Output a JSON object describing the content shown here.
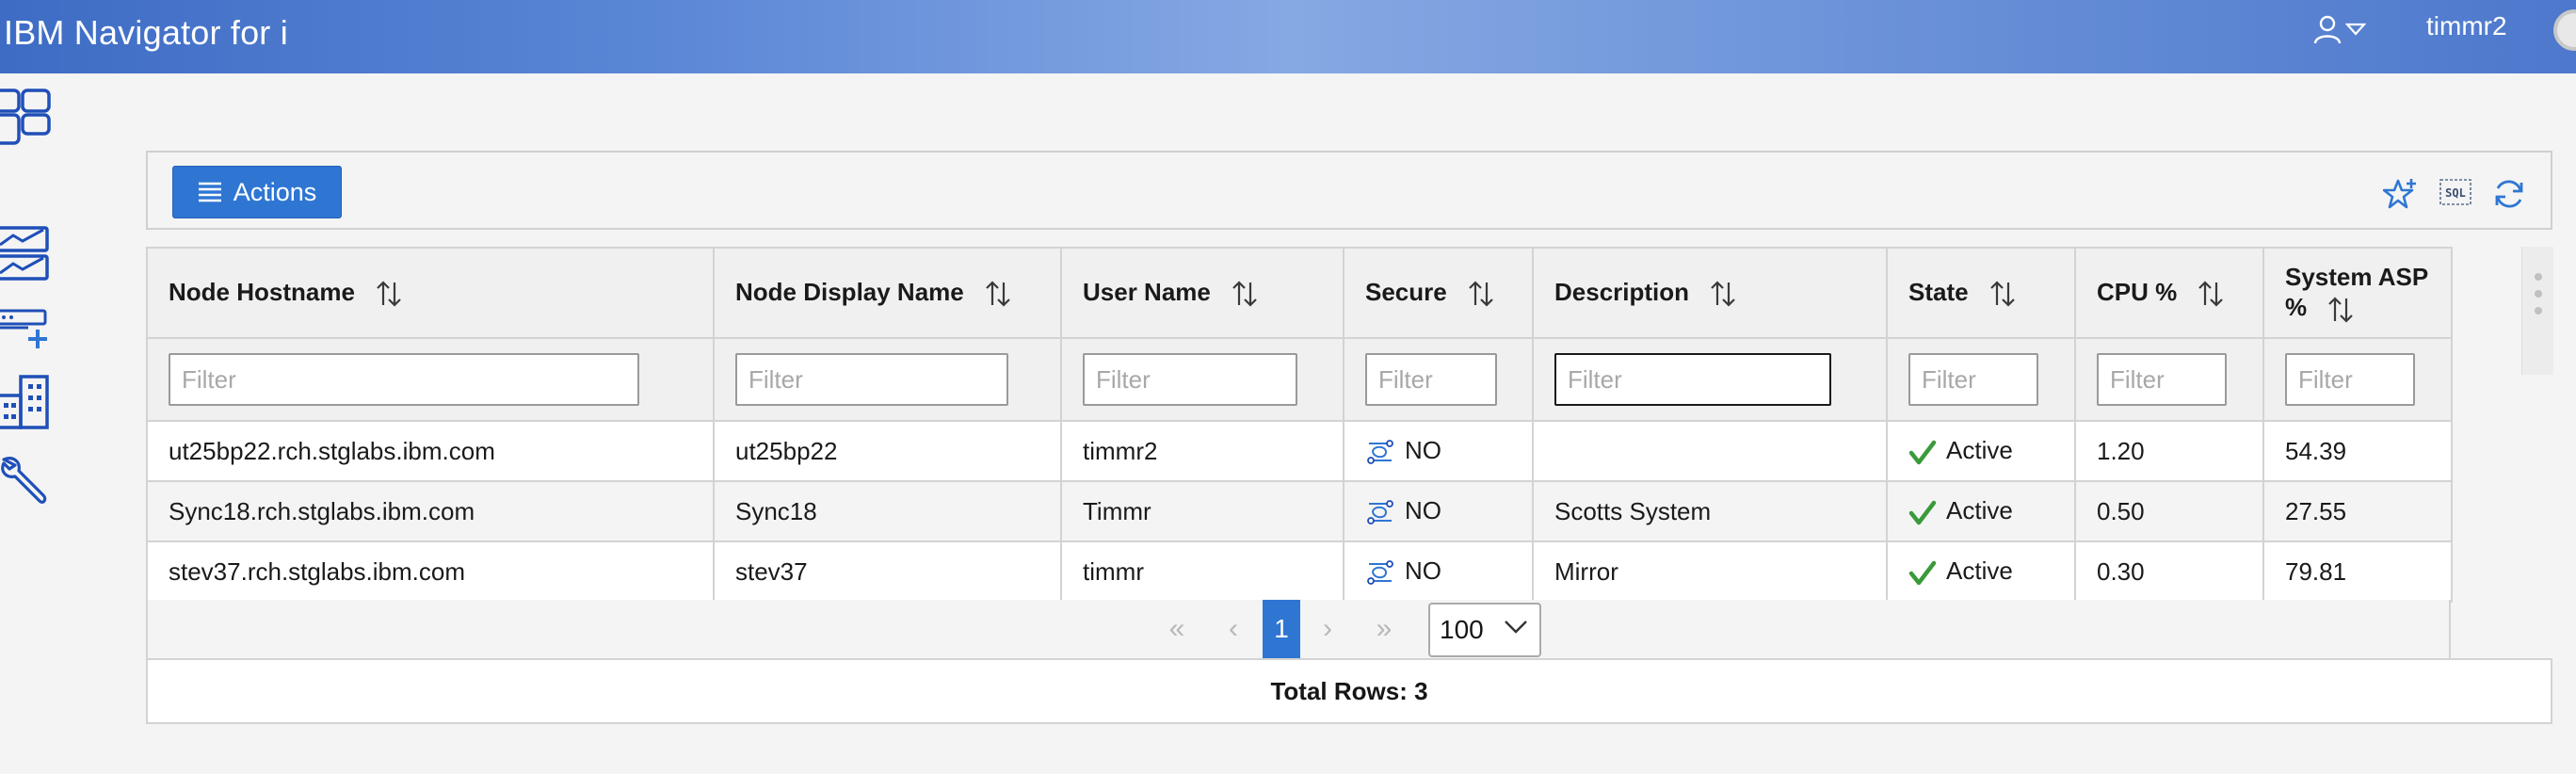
{
  "header": {
    "title": "IBM Navigator for i",
    "username": "timmr2",
    "user_icon": "user-icon",
    "menu_icon": "caret-down-icon"
  },
  "leftnav": {
    "items": [
      {
        "icon": "dashboard-icon"
      },
      {
        "icon": "monitor-icon"
      },
      {
        "icon": "add-system-icon"
      },
      {
        "icon": "building-icon"
      },
      {
        "icon": "wrench-icon"
      }
    ]
  },
  "toolbar": {
    "actions_label": "Actions",
    "icons": [
      "favorite-star-icon",
      "sql-icon",
      "refresh-icon"
    ]
  },
  "table": {
    "columns": [
      {
        "label": "Node Hostname"
      },
      {
        "label": "Node Display Name"
      },
      {
        "label": "User Name"
      },
      {
        "label": "Secure"
      },
      {
        "label": "Description"
      },
      {
        "label": "State"
      },
      {
        "label": "CPU %"
      },
      {
        "label": "System ASP %"
      }
    ],
    "filter_placeholder": "Filter",
    "rows": [
      {
        "hostname": "ut25bp22.rch.stglabs.ibm.com",
        "display_name": "ut25bp22",
        "user": "timmr2",
        "secure": "NO",
        "description": "",
        "state": "Active",
        "cpu": "1.20",
        "asp": "54.39"
      },
      {
        "hostname": "Sync18.rch.stglabs.ibm.com",
        "display_name": "Sync18",
        "user": "Timmr",
        "secure": "NO",
        "description": "Scotts System",
        "state": "Active",
        "cpu": "0.50",
        "asp": "27.55"
      },
      {
        "hostname": "stev37.rch.stglabs.ibm.com",
        "display_name": "stev37",
        "user": "timmr",
        "secure": "NO",
        "description": "Mirror",
        "state": "Active",
        "cpu": "0.30",
        "asp": "79.81"
      }
    ]
  },
  "pager": {
    "first": "«",
    "prev": "‹",
    "current_page": "1",
    "next": "›",
    "last": "»",
    "page_size": "100"
  },
  "footer": {
    "total_rows": "Total Rows: 3"
  },
  "colors": {
    "accent": "#2f76d3",
    "active_check": "#3a9a3a",
    "icon_blue": "#1f4fb8"
  }
}
